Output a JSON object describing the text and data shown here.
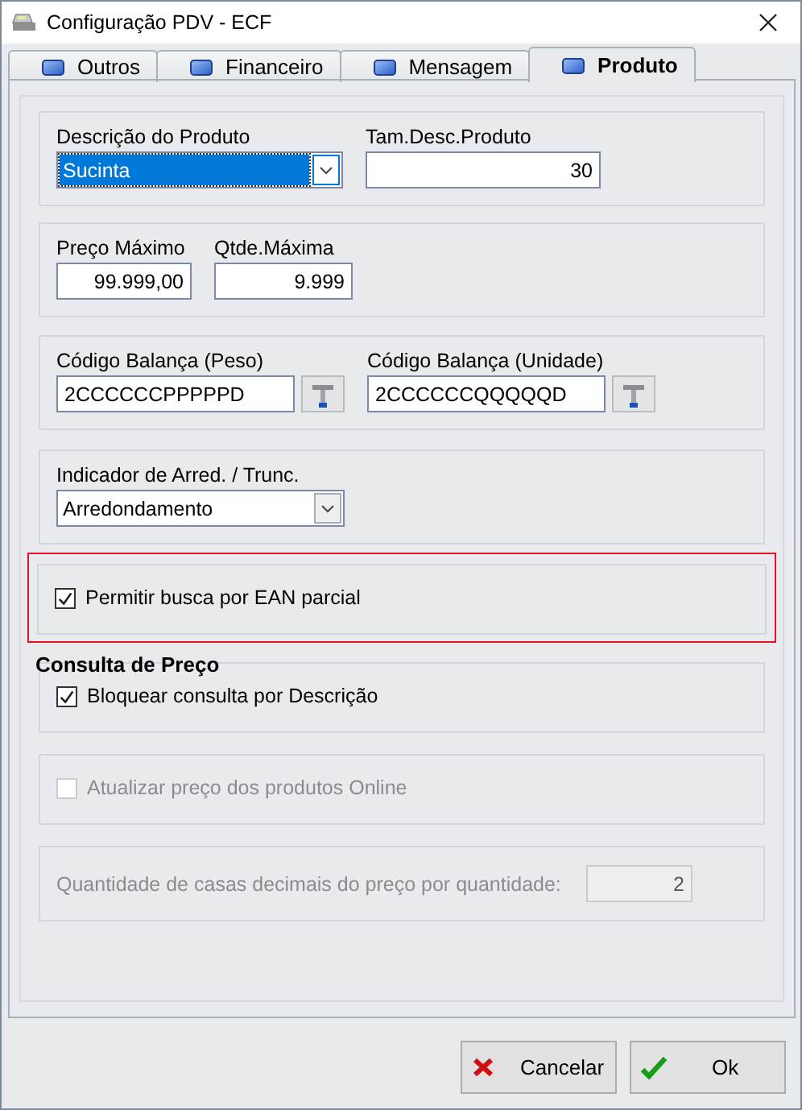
{
  "window": {
    "title": "Configuração PDV - ECF"
  },
  "tabs": [
    {
      "label": "Outros",
      "selected": false
    },
    {
      "label": "Financeiro",
      "selected": false
    },
    {
      "label": "Mensagem",
      "selected": false
    },
    {
      "label": "Produto",
      "selected": true
    }
  ],
  "sections": [
    {
      "kind": "fields",
      "fields": [
        {
          "kind": "combo",
          "label": "Descrição do Produto",
          "value": "Sucinta",
          "focused": true
        },
        {
          "kind": "number",
          "label": "Tam.Desc.Produto",
          "value": "30"
        }
      ]
    },
    {
      "kind": "fields",
      "fields": [
        {
          "kind": "number",
          "label": "Preço Máximo",
          "value": "99.999,00"
        },
        {
          "kind": "number",
          "label": "Qtde.Máxima",
          "value": "9.999"
        }
      ]
    },
    {
      "kind": "fields",
      "fields": [
        {
          "kind": "code",
          "label": "Código Balança (Peso)",
          "value": "2CCCCCCPPPPPD"
        },
        {
          "kind": "code",
          "label": "Código Balança (Unidade)",
          "value": "2CCCCCCQQQQQD"
        }
      ]
    },
    {
      "kind": "fields",
      "fields": [
        {
          "kind": "combo",
          "label": "Indicador de Arred. / Trunc.",
          "value": "Arredondamento",
          "focused": false
        }
      ]
    },
    {
      "kind": "checkbox",
      "label": "Permitir busca por EAN parcial",
      "checked": true,
      "disabled": false,
      "highlighted": true
    },
    {
      "kind": "checkbox",
      "title": "Consulta de Preço",
      "label": "Bloquear consulta por Descrição",
      "checked": true,
      "disabled": false,
      "highlighted": false
    },
    {
      "kind": "checkbox",
      "label": "Atualizar preço dos produtos Online",
      "checked": false,
      "disabled": true,
      "highlighted": false
    },
    {
      "kind": "inline_field",
      "label": "Quantidade de casas decimais do preço por quantidade:",
      "value": "2",
      "disabled": true
    }
  ],
  "buttons": [
    {
      "kind": "cancel",
      "label": "Cancelar"
    },
    {
      "kind": "ok",
      "label": "Ok"
    }
  ]
}
